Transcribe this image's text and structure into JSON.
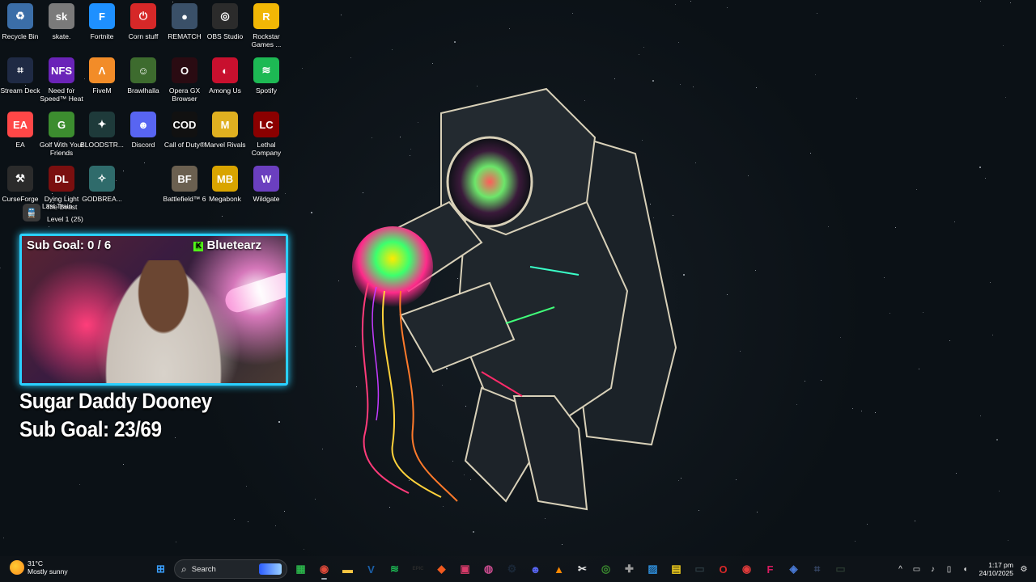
{
  "desktop_icons": [
    {
      "label": "Recycle Bin",
      "icon": "recycle-bin-icon",
      "color": "#3b6ea8",
      "glyph": "♻"
    },
    {
      "label": "skate.",
      "icon": "skate-icon",
      "color": "#7a7a7a",
      "glyph": "sk"
    },
    {
      "label": "Fortnite",
      "icon": "fortnite-icon",
      "color": "#1e90ff",
      "glyph": "F"
    },
    {
      "label": "Corn stuff",
      "icon": "power-icon",
      "color": "#d62828",
      "glyph": "⏻"
    },
    {
      "label": "REMATCH",
      "icon": "rematch-icon",
      "color": "#3a5068",
      "glyph": "●"
    },
    {
      "label": "OBS Studio",
      "icon": "obs-icon",
      "color": "#2b2b2b",
      "glyph": "◎"
    },
    {
      "label": "Rockstar Games ...",
      "icon": "rockstar-icon",
      "color": "#f2b705",
      "glyph": "R"
    },
    {
      "label": "Stream Deck",
      "icon": "stream-deck-icon",
      "color": "#1f2a44",
      "glyph": "⌗"
    },
    {
      "label": "Need for Speed™ Heat",
      "icon": "nfs-icon",
      "color": "#6a23b8",
      "glyph": "NFS"
    },
    {
      "label": "FiveM",
      "icon": "fivem-icon",
      "color": "#f28c28",
      "glyph": "Λ"
    },
    {
      "label": "Brawlhalla",
      "icon": "brawlhalla-icon",
      "color": "#3d6b2e",
      "glyph": "☺"
    },
    {
      "label": "Opera GX Browser",
      "icon": "opera-gx-icon",
      "color": "#2a0b12",
      "glyph": "O"
    },
    {
      "label": "Among Us",
      "icon": "among-us-icon",
      "color": "#c8102e",
      "glyph": "◐"
    },
    {
      "label": "Spotify",
      "icon": "spotify-icon",
      "color": "#1db954",
      "glyph": "≋"
    },
    {
      "label": "EA",
      "icon": "ea-icon",
      "color": "#ff4747",
      "glyph": "EA"
    },
    {
      "label": "Golf With Your Friends",
      "icon": "golf-icon",
      "color": "#3c8d2f",
      "glyph": "G"
    },
    {
      "label": "BLOODSTR...",
      "icon": "bloodstrike-icon",
      "color": "#1e3a3a",
      "glyph": "✦"
    },
    {
      "label": "Discord",
      "icon": "discord-icon",
      "color": "#5865f2",
      "glyph": "☻"
    },
    {
      "label": "Call of Duty®",
      "icon": "cod-icon",
      "color": "#111111",
      "glyph": "COD"
    },
    {
      "label": "Marvel Rivals",
      "icon": "marvel-rivals-icon",
      "color": "#e0b020",
      "glyph": "M"
    },
    {
      "label": "Lethal Company",
      "icon": "lethal-company-icon",
      "color": "#8b0000",
      "glyph": "LC"
    },
    {
      "label": "CurseForge",
      "icon": "curseforge-icon",
      "color": "#2b2b2b",
      "glyph": "⚒"
    },
    {
      "label": "Dying Light The Beast",
      "icon": "dying-light-icon",
      "color": "#7a0f0f",
      "glyph": "DL"
    },
    {
      "label": "GODBREA...",
      "icon": "godbreakers-icon",
      "color": "#2f6b6b",
      "glyph": "✧"
    },
    {
      "label": "Battlefield™ 6",
      "icon": "battlefield-icon",
      "color": "#6b6050",
      "glyph": "BF"
    },
    {
      "label": "Megabonk",
      "icon": "megabonk-icon",
      "color": "#d9a400",
      "glyph": "MB"
    },
    {
      "label": "Wildgate",
      "icon": "wildgate-icon",
      "color": "#6b3fbf",
      "glyph": "W"
    },
    {
      "label": "Last Train",
      "icon": "train-icon",
      "color": "#3a3a3a",
      "glyph": "🚆"
    }
  ],
  "last_train_status": "Level 1 (25)",
  "stream_overlay": {
    "cam_sub_goal": "Sub Goal: 0 / 6",
    "cam_name": "Bluetearz",
    "kick_glyph": "K",
    "title": "Sugar Daddy Dooney",
    "sub_goal": "Sub Goal: 23/69"
  },
  "taskbar": {
    "weather_temp": "31°C",
    "weather_desc": "Mostly sunny",
    "search_placeholder": "Search",
    "apps": [
      {
        "icon": "windows-start-icon",
        "color": "#3aa0ff",
        "glyph": "⊞"
      },
      {
        "icon": "xbox-icon",
        "color": "#2bb34a",
        "glyph": "▦"
      },
      {
        "icon": "chrome-icon",
        "color": "#e04a3a",
        "glyph": "◉"
      },
      {
        "icon": "file-explorer-icon",
        "color": "#f5c542",
        "glyph": "▬"
      },
      {
        "icon": "vegas-icon",
        "color": "#1b5fa8",
        "glyph": "V"
      },
      {
        "icon": "spotify-icon",
        "color": "#1db954",
        "glyph": "≋"
      },
      {
        "icon": "epic-games-icon",
        "color": "#2b2b2b",
        "glyph": "EPIC"
      },
      {
        "icon": "brave-icon",
        "color": "#f25a1f",
        "glyph": "◆"
      },
      {
        "icon": "clipchamp-icon",
        "color": "#d83b6a",
        "glyph": "▣"
      },
      {
        "icon": "web-icon",
        "color": "#c84b8d",
        "glyph": "◍"
      },
      {
        "icon": "steam-icon",
        "color": "#1b2838",
        "glyph": "⚙"
      },
      {
        "icon": "discord-icon",
        "color": "#5865f2",
        "glyph": "☻"
      },
      {
        "icon": "vlc-icon",
        "color": "#ff8800",
        "glyph": "▲"
      },
      {
        "icon": "capcut-icon",
        "color": "#e6e6e6",
        "glyph": "✂"
      },
      {
        "icon": "xbox-app-icon",
        "color": "#3c8d2f",
        "glyph": "◎"
      },
      {
        "icon": "cross-icon",
        "color": "#9a9a9a",
        "glyph": "✚"
      },
      {
        "icon": "photos-icon",
        "color": "#2f8fdc",
        "glyph": "▨"
      },
      {
        "icon": "sticky-notes-icon",
        "color": "#f7d21c",
        "glyph": "▤"
      },
      {
        "icon": "terminal-icon",
        "color": "#2b3a40",
        "glyph": "▭"
      },
      {
        "icon": "opera-gx-icon",
        "color": "#d62828",
        "glyph": "O"
      },
      {
        "icon": "recorder-icon",
        "color": "#e23b3b",
        "glyph": "◉"
      },
      {
        "icon": "figma-icon",
        "color": "#d81b60",
        "glyph": "F"
      },
      {
        "icon": "vpn-icon",
        "color": "#4a7bd8",
        "glyph": "◈"
      },
      {
        "icon": "stream-deck-icon",
        "color": "#3a4a6a",
        "glyph": "⌗"
      },
      {
        "icon": "nvidia-icon",
        "color": "#2a3a30",
        "glyph": "▭"
      }
    ],
    "clock_time": "1:17 pm",
    "clock_date": "24/10/2025"
  }
}
